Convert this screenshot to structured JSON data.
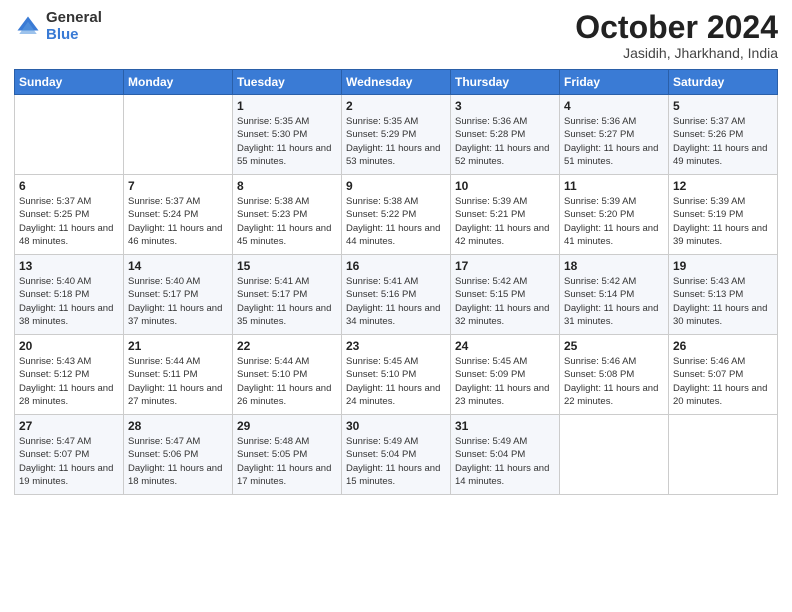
{
  "header": {
    "logo_general": "General",
    "logo_blue": "Blue",
    "month_title": "October 2024",
    "location": "Jasidih, Jharkhand, India"
  },
  "days_of_week": [
    "Sunday",
    "Monday",
    "Tuesday",
    "Wednesday",
    "Thursday",
    "Friday",
    "Saturday"
  ],
  "weeks": [
    [
      {
        "day": "",
        "info": ""
      },
      {
        "day": "",
        "info": ""
      },
      {
        "day": "1",
        "info": "Sunrise: 5:35 AM\nSunset: 5:30 PM\nDaylight: 11 hours and 55 minutes."
      },
      {
        "day": "2",
        "info": "Sunrise: 5:35 AM\nSunset: 5:29 PM\nDaylight: 11 hours and 53 minutes."
      },
      {
        "day": "3",
        "info": "Sunrise: 5:36 AM\nSunset: 5:28 PM\nDaylight: 11 hours and 52 minutes."
      },
      {
        "day": "4",
        "info": "Sunrise: 5:36 AM\nSunset: 5:27 PM\nDaylight: 11 hours and 51 minutes."
      },
      {
        "day": "5",
        "info": "Sunrise: 5:37 AM\nSunset: 5:26 PM\nDaylight: 11 hours and 49 minutes."
      }
    ],
    [
      {
        "day": "6",
        "info": "Sunrise: 5:37 AM\nSunset: 5:25 PM\nDaylight: 11 hours and 48 minutes."
      },
      {
        "day": "7",
        "info": "Sunrise: 5:37 AM\nSunset: 5:24 PM\nDaylight: 11 hours and 46 minutes."
      },
      {
        "day": "8",
        "info": "Sunrise: 5:38 AM\nSunset: 5:23 PM\nDaylight: 11 hours and 45 minutes."
      },
      {
        "day": "9",
        "info": "Sunrise: 5:38 AM\nSunset: 5:22 PM\nDaylight: 11 hours and 44 minutes."
      },
      {
        "day": "10",
        "info": "Sunrise: 5:39 AM\nSunset: 5:21 PM\nDaylight: 11 hours and 42 minutes."
      },
      {
        "day": "11",
        "info": "Sunrise: 5:39 AM\nSunset: 5:20 PM\nDaylight: 11 hours and 41 minutes."
      },
      {
        "day": "12",
        "info": "Sunrise: 5:39 AM\nSunset: 5:19 PM\nDaylight: 11 hours and 39 minutes."
      }
    ],
    [
      {
        "day": "13",
        "info": "Sunrise: 5:40 AM\nSunset: 5:18 PM\nDaylight: 11 hours and 38 minutes."
      },
      {
        "day": "14",
        "info": "Sunrise: 5:40 AM\nSunset: 5:17 PM\nDaylight: 11 hours and 37 minutes."
      },
      {
        "day": "15",
        "info": "Sunrise: 5:41 AM\nSunset: 5:17 PM\nDaylight: 11 hours and 35 minutes."
      },
      {
        "day": "16",
        "info": "Sunrise: 5:41 AM\nSunset: 5:16 PM\nDaylight: 11 hours and 34 minutes."
      },
      {
        "day": "17",
        "info": "Sunrise: 5:42 AM\nSunset: 5:15 PM\nDaylight: 11 hours and 32 minutes."
      },
      {
        "day": "18",
        "info": "Sunrise: 5:42 AM\nSunset: 5:14 PM\nDaylight: 11 hours and 31 minutes."
      },
      {
        "day": "19",
        "info": "Sunrise: 5:43 AM\nSunset: 5:13 PM\nDaylight: 11 hours and 30 minutes."
      }
    ],
    [
      {
        "day": "20",
        "info": "Sunrise: 5:43 AM\nSunset: 5:12 PM\nDaylight: 11 hours and 28 minutes."
      },
      {
        "day": "21",
        "info": "Sunrise: 5:44 AM\nSunset: 5:11 PM\nDaylight: 11 hours and 27 minutes."
      },
      {
        "day": "22",
        "info": "Sunrise: 5:44 AM\nSunset: 5:10 PM\nDaylight: 11 hours and 26 minutes."
      },
      {
        "day": "23",
        "info": "Sunrise: 5:45 AM\nSunset: 5:10 PM\nDaylight: 11 hours and 24 minutes."
      },
      {
        "day": "24",
        "info": "Sunrise: 5:45 AM\nSunset: 5:09 PM\nDaylight: 11 hours and 23 minutes."
      },
      {
        "day": "25",
        "info": "Sunrise: 5:46 AM\nSunset: 5:08 PM\nDaylight: 11 hours and 22 minutes."
      },
      {
        "day": "26",
        "info": "Sunrise: 5:46 AM\nSunset: 5:07 PM\nDaylight: 11 hours and 20 minutes."
      }
    ],
    [
      {
        "day": "27",
        "info": "Sunrise: 5:47 AM\nSunset: 5:07 PM\nDaylight: 11 hours and 19 minutes."
      },
      {
        "day": "28",
        "info": "Sunrise: 5:47 AM\nSunset: 5:06 PM\nDaylight: 11 hours and 18 minutes."
      },
      {
        "day": "29",
        "info": "Sunrise: 5:48 AM\nSunset: 5:05 PM\nDaylight: 11 hours and 17 minutes."
      },
      {
        "day": "30",
        "info": "Sunrise: 5:49 AM\nSunset: 5:04 PM\nDaylight: 11 hours and 15 minutes."
      },
      {
        "day": "31",
        "info": "Sunrise: 5:49 AM\nSunset: 5:04 PM\nDaylight: 11 hours and 14 minutes."
      },
      {
        "day": "",
        "info": ""
      },
      {
        "day": "",
        "info": ""
      }
    ]
  ]
}
